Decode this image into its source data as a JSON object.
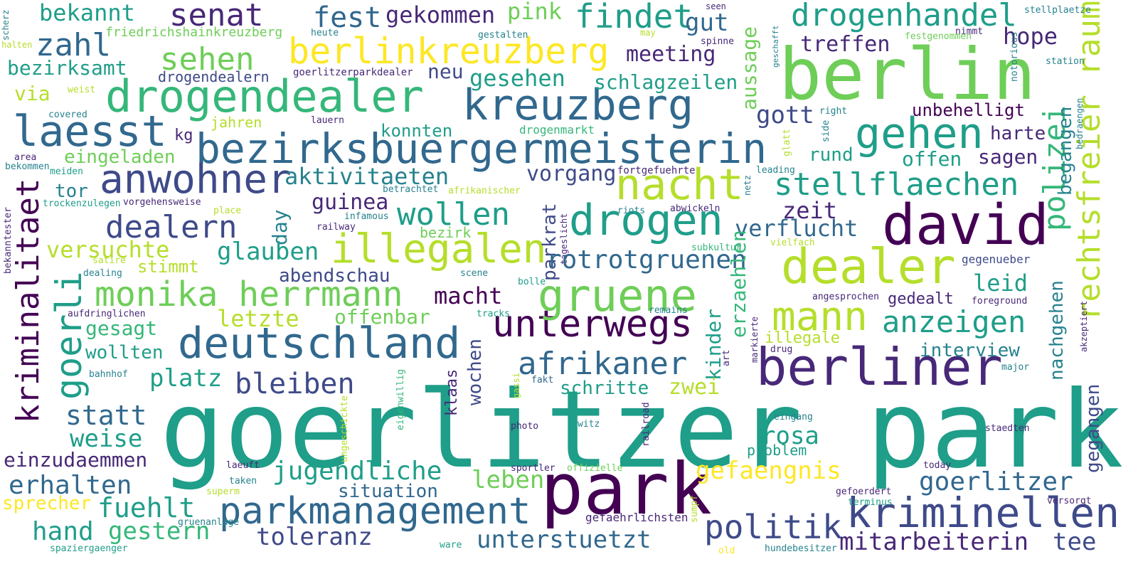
{
  "palette": {
    "dark_purple": "#440154",
    "indigo": "#482878",
    "slate_blue": "#3e4a89",
    "blue": "#31688e",
    "steel": "#26828e",
    "teal": "#1f9e89",
    "green": "#35b779",
    "light_green": "#6ece58",
    "lime": "#b5de2b",
    "yellow": "#fde725"
  },
  "words": [
    "goerlitzer park",
    "berlin",
    "bezirksbuergermeisterin",
    "drogendealer",
    "kreuzberg",
    "berlinkreuzberg",
    "david",
    "dealer",
    "berliner",
    "deutschland",
    "park",
    "parkmanagement",
    "unterwegs",
    "drogen",
    "nacht",
    "gehen",
    "laesst",
    "anwohner",
    "monika herrmann",
    "illegalen",
    "gruene",
    "politik",
    "kriminellen",
    "mann",
    "stellflaechen",
    "kriminalitaet",
    "goerli",
    "rechtsfreier raum",
    "polizei",
    "drogenhandel",
    "senat",
    "zahl",
    "findet",
    "fest",
    "gekommen",
    "pink",
    "gut",
    "meeting",
    "sehen",
    "bezirksamt",
    "bekannt",
    "friedrichshainkreuzberg",
    "hope",
    "treffen",
    "aussage",
    "gesehen",
    "schlagzeilen",
    "neu",
    "drogendealern",
    "goerlitzerparkdealer",
    "heute",
    "gestalten",
    "spinne",
    "seen",
    "stellplaetze",
    "nimmt",
    "geschafft",
    "festgenommen",
    "notorious",
    "station",
    "scherz",
    "halten",
    "may",
    "via",
    "weist",
    "covered",
    "gott",
    "unbehelligt",
    "right",
    "side",
    "glatt",
    "begangen",
    "bedraengen",
    "harte",
    "sagen",
    "offen",
    "rund",
    "leading",
    "netz",
    "kg",
    "jahren",
    "lauern",
    "konnten",
    "drogenmarkt",
    "eingeladen",
    "area",
    "bekommen",
    "meiden",
    "tor",
    "aktivitaeten",
    "vorgang",
    "fortgefuehrte",
    "betrachtet",
    "afrikanischer",
    "trockenzulegen",
    "vorgehensweise",
    "place",
    "guinea",
    "infamous",
    "railway",
    "riots",
    "abwickeln",
    "zeit",
    "verflucht",
    "dealern",
    "wollen",
    "day",
    "parkrat",
    "tageslicht",
    "subkultur",
    "vielfach",
    "versuchte",
    "glauben",
    "bezirk",
    "rotrotgruenen",
    "gegenueber",
    "bekanntester",
    "satire",
    "stimmt",
    "dealing",
    "abendschau",
    "scene",
    "bolle",
    "leid",
    "angesprochen",
    "foreground",
    "gedealt",
    "nachgehen",
    "gegangen",
    "akzeptiert",
    "macht",
    "letzte",
    "offenbar",
    "aufdringlichen",
    "tracks",
    "remains",
    "anzeigen",
    "gesagt",
    "wollten",
    "erzaehlen",
    "kinder",
    "illegale",
    "interview",
    "drug",
    "art",
    "markierte",
    "major",
    "platz",
    "bleiben",
    "afrikaner",
    "wochen",
    "bahnhof",
    "fakt",
    "gassi",
    "schritte",
    "zwei",
    "statt",
    "weise",
    "klaas",
    "eigenwillig",
    "ungeschickte",
    "railroad",
    "photo",
    "witz",
    "eingang",
    "rosa",
    "problem",
    "staedten",
    "einzudaemmen",
    "jugendliche",
    "gefaengnis",
    "goerlitzer",
    "erhalten",
    "laeuft",
    "taken",
    "sportler",
    "offizielle",
    "today",
    "superm",
    "situation",
    "leben",
    "fuehlt",
    "sprecher",
    "hand",
    "gestern",
    "gefoerdert",
    "terminus",
    "versorgt",
    "sumpf",
    "gefaehrlichsten",
    "gruenanlage",
    "toleranz",
    "unterstuetzt",
    "mitarbeiterin",
    "tee",
    "ware",
    "old",
    "hundebesitzer",
    "spaziergaenger"
  ]
}
